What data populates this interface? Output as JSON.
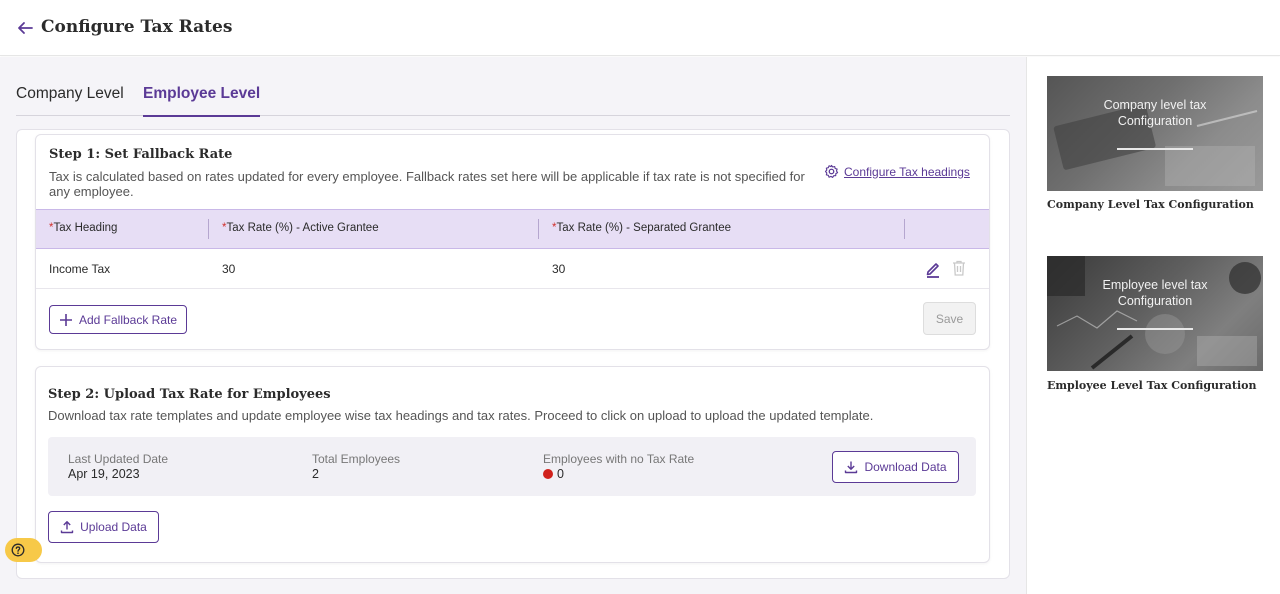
{
  "header": {
    "title": "Configure Tax Rates"
  },
  "tabs": [
    {
      "label": "Company Level",
      "active": false
    },
    {
      "label": "Employee Level",
      "active": true
    }
  ],
  "step1": {
    "title": "Step 1: Set Fallback Rate",
    "description": "Tax is calculated based on rates updated for every employee. Fallback rates set here will be applicable if tax rate is not specified for any employee.",
    "configure_link": "Configure Tax headings",
    "table": {
      "required_mark": "*",
      "headers": [
        "Tax Heading",
        "Tax Rate (%) - Active Grantee",
        "Tax Rate (%) - Separated Grantee"
      ],
      "rows": [
        {
          "heading": "Income Tax",
          "active_rate": "30",
          "separated_rate": "30"
        }
      ]
    },
    "add_button": "Add Fallback Rate",
    "save_button": "Save"
  },
  "step2": {
    "title": "Step 2: Upload Tax Rate for Employees",
    "description": "Download tax rate templates and update employee wise tax headings and tax rates. Proceed to click on upload to upload the updated template.",
    "last_updated_label": "Last Updated Date",
    "last_updated_value": "Apr 19, 2023",
    "total_employees_label": "Total Employees",
    "total_employees_value": "2",
    "no_rate_label": "Employees with no Tax Rate",
    "no_rate_value": "0",
    "download_button": "Download Data",
    "upload_button": "Upload Data"
  },
  "sidebar": {
    "cards": [
      {
        "thumb_line1": "Company level tax",
        "thumb_line2": "Configuration",
        "caption": "Company Level Tax Configuration"
      },
      {
        "thumb_line1": "Employee level tax",
        "thumb_line2": "Configuration",
        "caption": "Employee Level Tax Configuration"
      }
    ]
  },
  "colors": {
    "accent": "#5b3a96",
    "table_header_bg": "#e7def5",
    "required": "#d0312d",
    "status_red": "#d0211c",
    "help_badge": "#f7c948"
  },
  "icons": [
    "arrow-left-icon",
    "gear-icon",
    "plus-icon",
    "edit-icon",
    "trash-icon",
    "download-icon",
    "upload-icon",
    "help-icon"
  ]
}
